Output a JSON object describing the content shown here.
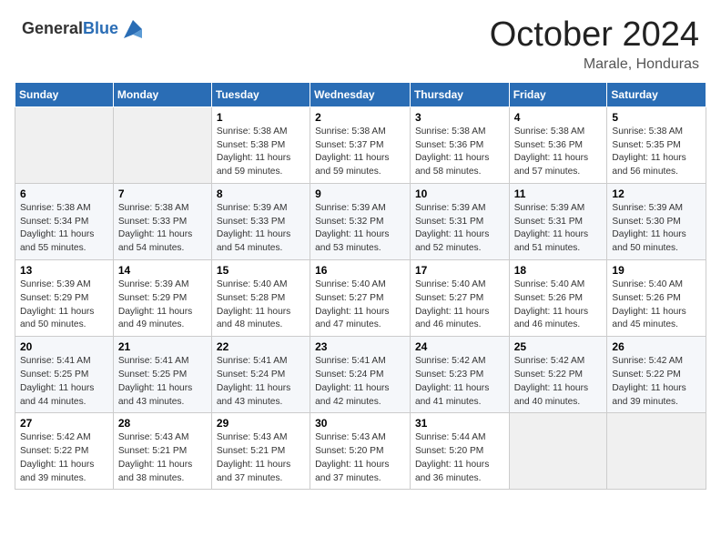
{
  "header": {
    "logo_general": "General",
    "logo_blue": "Blue",
    "month": "October 2024",
    "location": "Marale, Honduras"
  },
  "days_of_week": [
    "Sunday",
    "Monday",
    "Tuesday",
    "Wednesday",
    "Thursday",
    "Friday",
    "Saturday"
  ],
  "weeks": [
    [
      {
        "day": "",
        "info": ""
      },
      {
        "day": "",
        "info": ""
      },
      {
        "day": "1",
        "info": "Sunrise: 5:38 AM\nSunset: 5:38 PM\nDaylight: 11 hours and 59 minutes."
      },
      {
        "day": "2",
        "info": "Sunrise: 5:38 AM\nSunset: 5:37 PM\nDaylight: 11 hours and 59 minutes."
      },
      {
        "day": "3",
        "info": "Sunrise: 5:38 AM\nSunset: 5:36 PM\nDaylight: 11 hours and 58 minutes."
      },
      {
        "day": "4",
        "info": "Sunrise: 5:38 AM\nSunset: 5:36 PM\nDaylight: 11 hours and 57 minutes."
      },
      {
        "day": "5",
        "info": "Sunrise: 5:38 AM\nSunset: 5:35 PM\nDaylight: 11 hours and 56 minutes."
      }
    ],
    [
      {
        "day": "6",
        "info": "Sunrise: 5:38 AM\nSunset: 5:34 PM\nDaylight: 11 hours and 55 minutes."
      },
      {
        "day": "7",
        "info": "Sunrise: 5:38 AM\nSunset: 5:33 PM\nDaylight: 11 hours and 54 minutes."
      },
      {
        "day": "8",
        "info": "Sunrise: 5:39 AM\nSunset: 5:33 PM\nDaylight: 11 hours and 54 minutes."
      },
      {
        "day": "9",
        "info": "Sunrise: 5:39 AM\nSunset: 5:32 PM\nDaylight: 11 hours and 53 minutes."
      },
      {
        "day": "10",
        "info": "Sunrise: 5:39 AM\nSunset: 5:31 PM\nDaylight: 11 hours and 52 minutes."
      },
      {
        "day": "11",
        "info": "Sunrise: 5:39 AM\nSunset: 5:31 PM\nDaylight: 11 hours and 51 minutes."
      },
      {
        "day": "12",
        "info": "Sunrise: 5:39 AM\nSunset: 5:30 PM\nDaylight: 11 hours and 50 minutes."
      }
    ],
    [
      {
        "day": "13",
        "info": "Sunrise: 5:39 AM\nSunset: 5:29 PM\nDaylight: 11 hours and 50 minutes."
      },
      {
        "day": "14",
        "info": "Sunrise: 5:39 AM\nSunset: 5:29 PM\nDaylight: 11 hours and 49 minutes."
      },
      {
        "day": "15",
        "info": "Sunrise: 5:40 AM\nSunset: 5:28 PM\nDaylight: 11 hours and 48 minutes."
      },
      {
        "day": "16",
        "info": "Sunrise: 5:40 AM\nSunset: 5:27 PM\nDaylight: 11 hours and 47 minutes."
      },
      {
        "day": "17",
        "info": "Sunrise: 5:40 AM\nSunset: 5:27 PM\nDaylight: 11 hours and 46 minutes."
      },
      {
        "day": "18",
        "info": "Sunrise: 5:40 AM\nSunset: 5:26 PM\nDaylight: 11 hours and 46 minutes."
      },
      {
        "day": "19",
        "info": "Sunrise: 5:40 AM\nSunset: 5:26 PM\nDaylight: 11 hours and 45 minutes."
      }
    ],
    [
      {
        "day": "20",
        "info": "Sunrise: 5:41 AM\nSunset: 5:25 PM\nDaylight: 11 hours and 44 minutes."
      },
      {
        "day": "21",
        "info": "Sunrise: 5:41 AM\nSunset: 5:25 PM\nDaylight: 11 hours and 43 minutes."
      },
      {
        "day": "22",
        "info": "Sunrise: 5:41 AM\nSunset: 5:24 PM\nDaylight: 11 hours and 43 minutes."
      },
      {
        "day": "23",
        "info": "Sunrise: 5:41 AM\nSunset: 5:24 PM\nDaylight: 11 hours and 42 minutes."
      },
      {
        "day": "24",
        "info": "Sunrise: 5:42 AM\nSunset: 5:23 PM\nDaylight: 11 hours and 41 minutes."
      },
      {
        "day": "25",
        "info": "Sunrise: 5:42 AM\nSunset: 5:22 PM\nDaylight: 11 hours and 40 minutes."
      },
      {
        "day": "26",
        "info": "Sunrise: 5:42 AM\nSunset: 5:22 PM\nDaylight: 11 hours and 39 minutes."
      }
    ],
    [
      {
        "day": "27",
        "info": "Sunrise: 5:42 AM\nSunset: 5:22 PM\nDaylight: 11 hours and 39 minutes."
      },
      {
        "day": "28",
        "info": "Sunrise: 5:43 AM\nSunset: 5:21 PM\nDaylight: 11 hours and 38 minutes."
      },
      {
        "day": "29",
        "info": "Sunrise: 5:43 AM\nSunset: 5:21 PM\nDaylight: 11 hours and 37 minutes."
      },
      {
        "day": "30",
        "info": "Sunrise: 5:43 AM\nSunset: 5:20 PM\nDaylight: 11 hours and 37 minutes."
      },
      {
        "day": "31",
        "info": "Sunrise: 5:44 AM\nSunset: 5:20 PM\nDaylight: 11 hours and 36 minutes."
      },
      {
        "day": "",
        "info": ""
      },
      {
        "day": "",
        "info": ""
      }
    ]
  ]
}
